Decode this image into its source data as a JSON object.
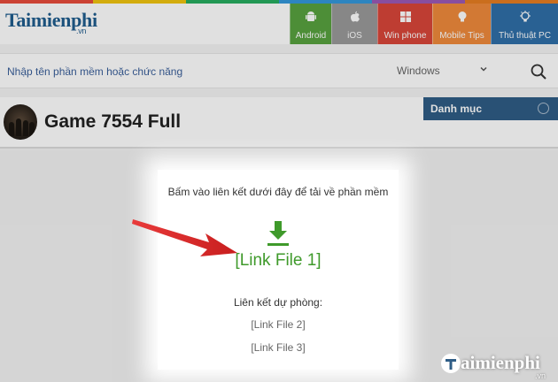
{
  "header": {
    "logo_text": "Taimienphi",
    "logo_suffix": ".vn",
    "strip_colors": [
      "#e74c3c",
      "#f1c40f",
      "#27ae60",
      "#3498db",
      "#9b59b6",
      "#e67e22"
    ],
    "nav": [
      {
        "label": "Android",
        "color": "#58a23f",
        "icon": "android-icon"
      },
      {
        "label": "iOS",
        "color": "#9a9a9a",
        "icon": "apple-icon"
      },
      {
        "label": "Win phone",
        "color": "#d9463a",
        "icon": "windows-icon"
      },
      {
        "label": "Mobile Tips",
        "color": "#ef8a3c",
        "icon": "lightbulb-icon"
      },
      {
        "label": "Thủ thuật PC",
        "color": "#2f6fa8",
        "icon": "bulb-icon"
      }
    ]
  },
  "search": {
    "placeholder": "Nhập tên phần mềm hoặc chức năng",
    "platform": "Windows"
  },
  "page": {
    "title": "Game 7554 Full",
    "sidebar_title": "Danh mục"
  },
  "download": {
    "instruction": "Bấm vào liên kết dưới đây để tải về phần mềm",
    "link1": "[Link File 1]",
    "backup_label": "Liên kết dự phòng:",
    "link2": "[Link File 2]",
    "link3": "[Link File 3]",
    "accent_color": "#3f9a2b"
  },
  "watermark": {
    "text": "aimienphi",
    "suffix": ".vn"
  }
}
